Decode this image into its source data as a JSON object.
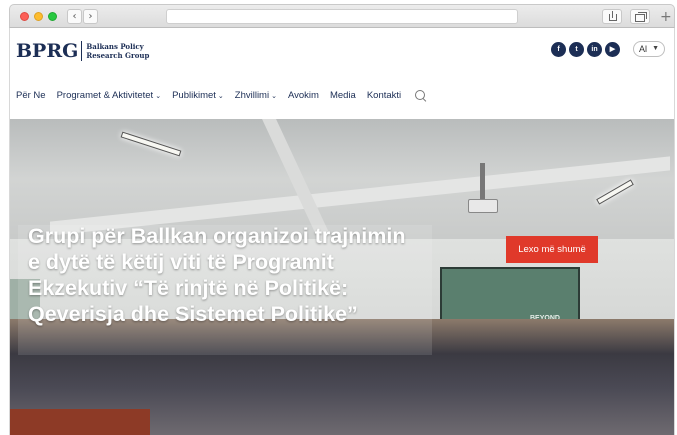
{
  "browser": {
    "back_glyph": "‹",
    "forward_glyph": "›",
    "new_tab_glyph": "+"
  },
  "logo": {
    "mark": "BPRG",
    "line1": "Balkans Policy",
    "line2": "Research Group"
  },
  "socials": [
    {
      "icon": "facebook-icon",
      "glyph": "f"
    },
    {
      "icon": "twitter-icon",
      "glyph": "t"
    },
    {
      "icon": "linkedin-icon",
      "glyph": "in"
    },
    {
      "icon": "youtube-icon",
      "glyph": "▶"
    }
  ],
  "language": {
    "selected": "Al",
    "caret": "▼"
  },
  "nav": {
    "items": [
      {
        "label": "Për Ne",
        "has_dropdown": false
      },
      {
        "label": "Programet & Aktivitetet",
        "has_dropdown": true
      },
      {
        "label": "Publikimet",
        "has_dropdown": true
      },
      {
        "label": "Zhvillimi",
        "has_dropdown": true
      },
      {
        "label": "Avokim",
        "has_dropdown": false
      },
      {
        "label": "Media",
        "has_dropdown": false
      },
      {
        "label": "Kontakti",
        "has_dropdown": false
      }
    ],
    "chevron": "⌄"
  },
  "hero": {
    "headline": "Grupi për Ballkan organizoi trajnimin e dytë të këtij viti të Programit Ekzekutiv “Të rinjtë në Politikë: Qeverisja dhe Sistemet Politike”",
    "cta": "Lexo më shumë",
    "screen_word": "BEYOND"
  },
  "colors": {
    "brand_navy": "#1c2e55",
    "cta_red": "#e0392a"
  }
}
